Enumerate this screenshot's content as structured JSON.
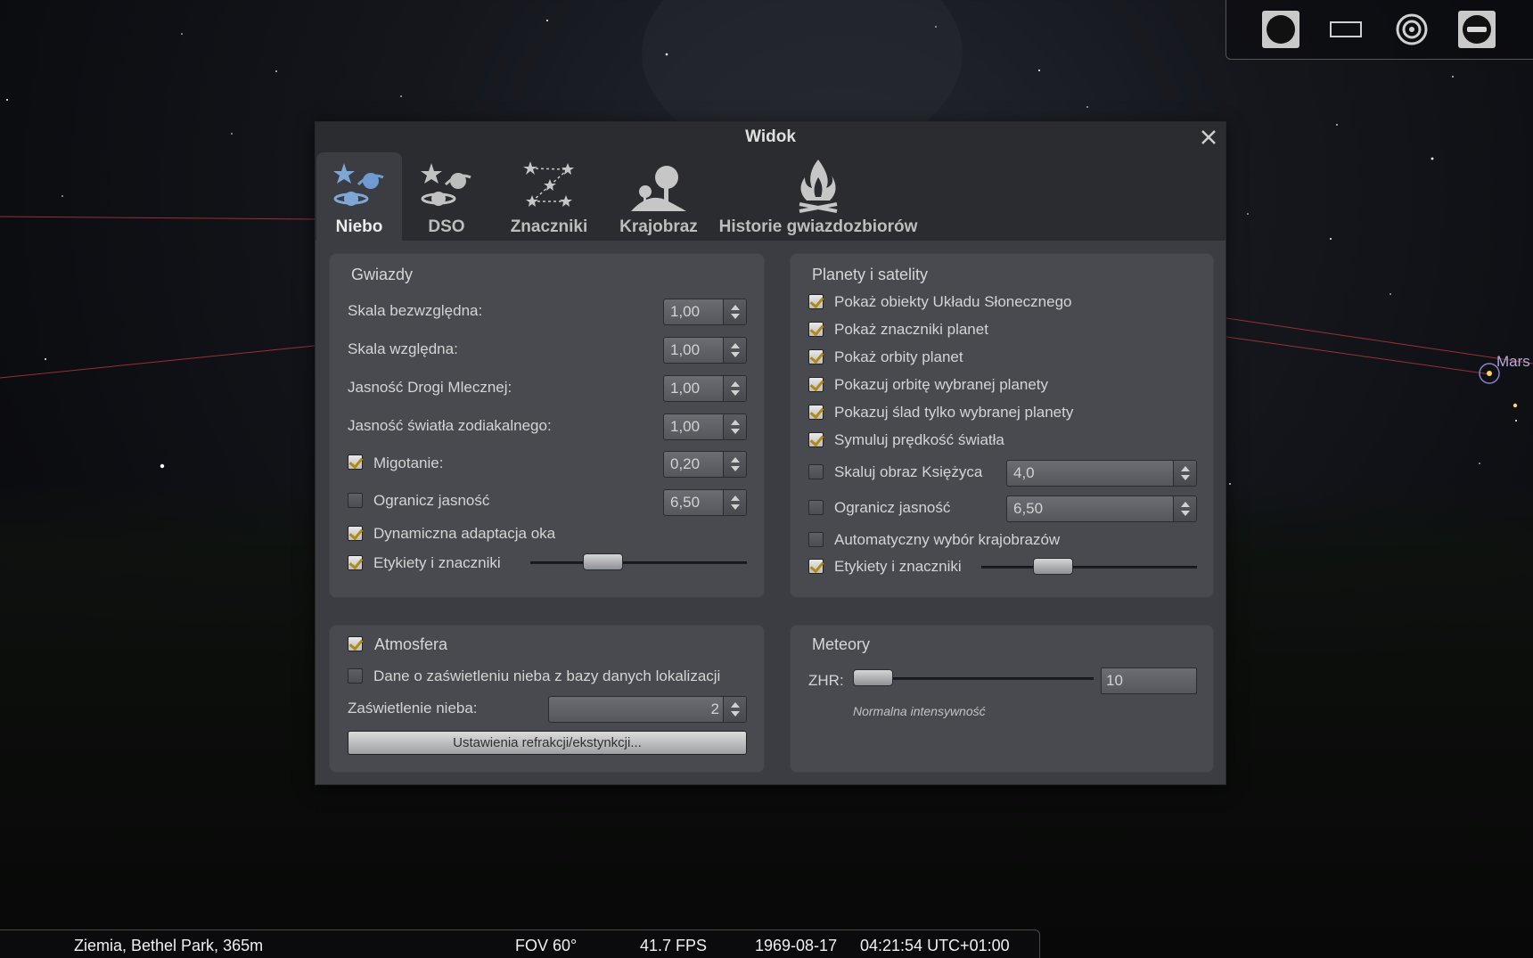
{
  "dialog": {
    "title": "Widok",
    "tabs": [
      {
        "label": "Niebo",
        "icon": "sky-icon"
      },
      {
        "label": "DSO",
        "icon": "dso-icon"
      },
      {
        "label": "Znaczniki",
        "icon": "markings-icon"
      },
      {
        "label": "Krajobraz",
        "icon": "landscape-icon"
      },
      {
        "label": "Historie gwiazdozbiorów",
        "icon": "starlore-icon"
      }
    ],
    "active_tab": "Niebo"
  },
  "stars": {
    "title": "Gwiazdy",
    "absolute_scale": {
      "label": "Skala bezwzględna:",
      "value": "1,00"
    },
    "relative_scale": {
      "label": "Skala względna:",
      "value": "1,00"
    },
    "milky_way": {
      "label": "Jasność Drogi Mlecznej:",
      "value": "1,00"
    },
    "zodiacal": {
      "label": "Jasność światła zodiakalnego:",
      "value": "1,00"
    },
    "twinkle": {
      "label": "Migotanie:",
      "value": "0,20",
      "checked": true
    },
    "limit_mag": {
      "label": "Ogranicz jasność",
      "value": "6,50",
      "checked": false
    },
    "adaptation": {
      "label": "Dynamiczna adaptacja oka",
      "checked": true
    },
    "labels": {
      "label": "Etykiety i znaczniki",
      "checked": true,
      "level": 0.35
    }
  },
  "planets": {
    "title": "Planety i satelity",
    "show_solar_system": {
      "label": "Pokaż obiekty Układu Słonecznego",
      "checked": true
    },
    "show_markers": {
      "label": "Pokaż znaczniki planet",
      "checked": true
    },
    "show_orbits": {
      "label": "Pokaż orbity planet",
      "checked": true
    },
    "selected_orbit": {
      "label": "Pokazuj orbitę wybranej planety",
      "checked": true
    },
    "selected_trail": {
      "label": "Pokazuj ślad tylko wybranej planety",
      "checked": true
    },
    "light_speed": {
      "label": "Symuluj prędkość światła",
      "checked": true
    },
    "moon_scale": {
      "label": "Skaluj obraz Księżyca",
      "value": "4,0",
      "checked": false
    },
    "limit_mag": {
      "label": "Ogranicz jasność",
      "value": "6,50",
      "checked": false
    },
    "auto_landscape": {
      "label": "Automatyczny wybór krajobrazów",
      "checked": false
    },
    "labels": {
      "label": "Etykiety i znaczniki",
      "checked": true,
      "level": 0.35
    }
  },
  "atmosphere": {
    "title": "Atmosfera",
    "checked": true,
    "light_pollution_db": {
      "label": "Dane o zaświetleniu nieba z bazy danych lokalizacji",
      "checked": false
    },
    "light_pollution": {
      "label": "Zaświetlenie nieba:",
      "value": "2"
    },
    "refraction_button": "Ustawienia refrakcji/ekstynkcji..."
  },
  "meteors": {
    "title": "Meteory",
    "zhr_label": "ZHR:",
    "zhr_value": "10",
    "zhr_level": 0.0,
    "intensity_note": "Normalna intensywność"
  },
  "sky": {
    "mars_label": "Mars",
    "line_color": "#c0392b"
  },
  "toolbar": {
    "buttons": [
      "night-mode-icon",
      "fullscreen-icon",
      "target-icon",
      "toolbar-toggle-icon"
    ]
  },
  "status": {
    "location": "Ziemia, Bethel Park, 365m",
    "fov": "FOV 60°",
    "fps": "41.7 FPS",
    "date": "1969-08-17",
    "time": "04:21:54 UTC+01:00"
  },
  "colors": {
    "dialog_bg": "#3b3d42",
    "group_bg": "#484a4f",
    "check_accent": "#b08a14"
  }
}
